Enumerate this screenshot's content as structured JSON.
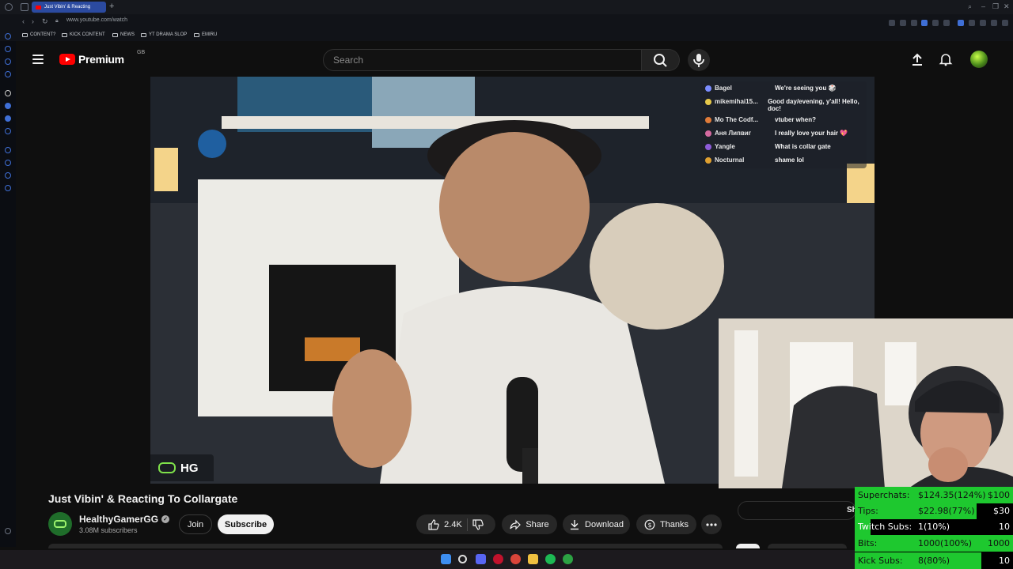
{
  "browser": {
    "tab_title": "Just Vibin' & Reacting",
    "new_tab": "+",
    "url": "www.youtube.com/watch",
    "bookmarks": [
      "CONTENT?",
      "KICK CONTENT",
      "NEWS",
      "YT DRAMA SLOP",
      "EMIRU"
    ]
  },
  "youtube": {
    "logo_text": "Premium",
    "region": "GB",
    "search_placeholder": "Search",
    "icons": {
      "menu": "menu-icon",
      "search": "search-icon",
      "mic": "mic-icon",
      "upload": "upload-icon",
      "notifications": "bell-icon"
    }
  },
  "video": {
    "chat": [
      {
        "name": "Bagel",
        "msg": "We're seeing you 🎲",
        "color": "#7b8cff"
      },
      {
        "name": "mikemihai15...",
        "msg": "Good day/evening, y'all! Hello, doc!",
        "color": "#e6c84a"
      },
      {
        "name": "Mo The Codf...",
        "msg": "vtuber when?",
        "color": "#e07b39"
      },
      {
        "name": "Аня Липвиг",
        "msg": "I really love your hair 💖",
        "color": "#d46aa0"
      },
      {
        "name": "Yangle",
        "msg": "What is collar gate",
        "color": "#8e5cd9"
      },
      {
        "name": "Nocturnal",
        "msg": "shame lol",
        "color": "#e0a030"
      }
    ],
    "badge_text": "HG"
  },
  "below": {
    "title": "Just Vibin' & Reacting To Collargate",
    "channel": "HealthyGamerGG",
    "subscribers": "3.08M subscribers",
    "join": "Join",
    "subscribe": "Subscribe",
    "likes": "2.4K",
    "share": "Share",
    "download": "Download",
    "thanks": "Thanks",
    "show_chat": "Show ch"
  },
  "stats": {
    "rows": [
      {
        "label": "Superchats:",
        "value": "$124.35(124%)",
        "goal": "$100",
        "fraction": 1.0,
        "bar": "#1ec82f",
        "fg": "#111"
      },
      {
        "label": "Tips:",
        "value": "$22.98(77%)",
        "goal": "$30",
        "fraction": 0.77,
        "bar": "#1ec82f",
        "fg": "#111"
      },
      {
        "label": "Twitch Subs:",
        "value": "1(10%)",
        "goal": "10",
        "fraction": 0.1,
        "bar": "#1ec82f",
        "fg": "#fff"
      },
      {
        "label": "Bits:",
        "value": "1000(100%)",
        "goal": "1000",
        "fraction": 1.0,
        "bar": "#1ec82f",
        "fg": "#111"
      },
      {
        "label": "Kick Subs:",
        "value": "8(80%)",
        "goal": "10",
        "fraction": 0.8,
        "bar": "#1ec82f",
        "fg": "#111"
      }
    ]
  }
}
